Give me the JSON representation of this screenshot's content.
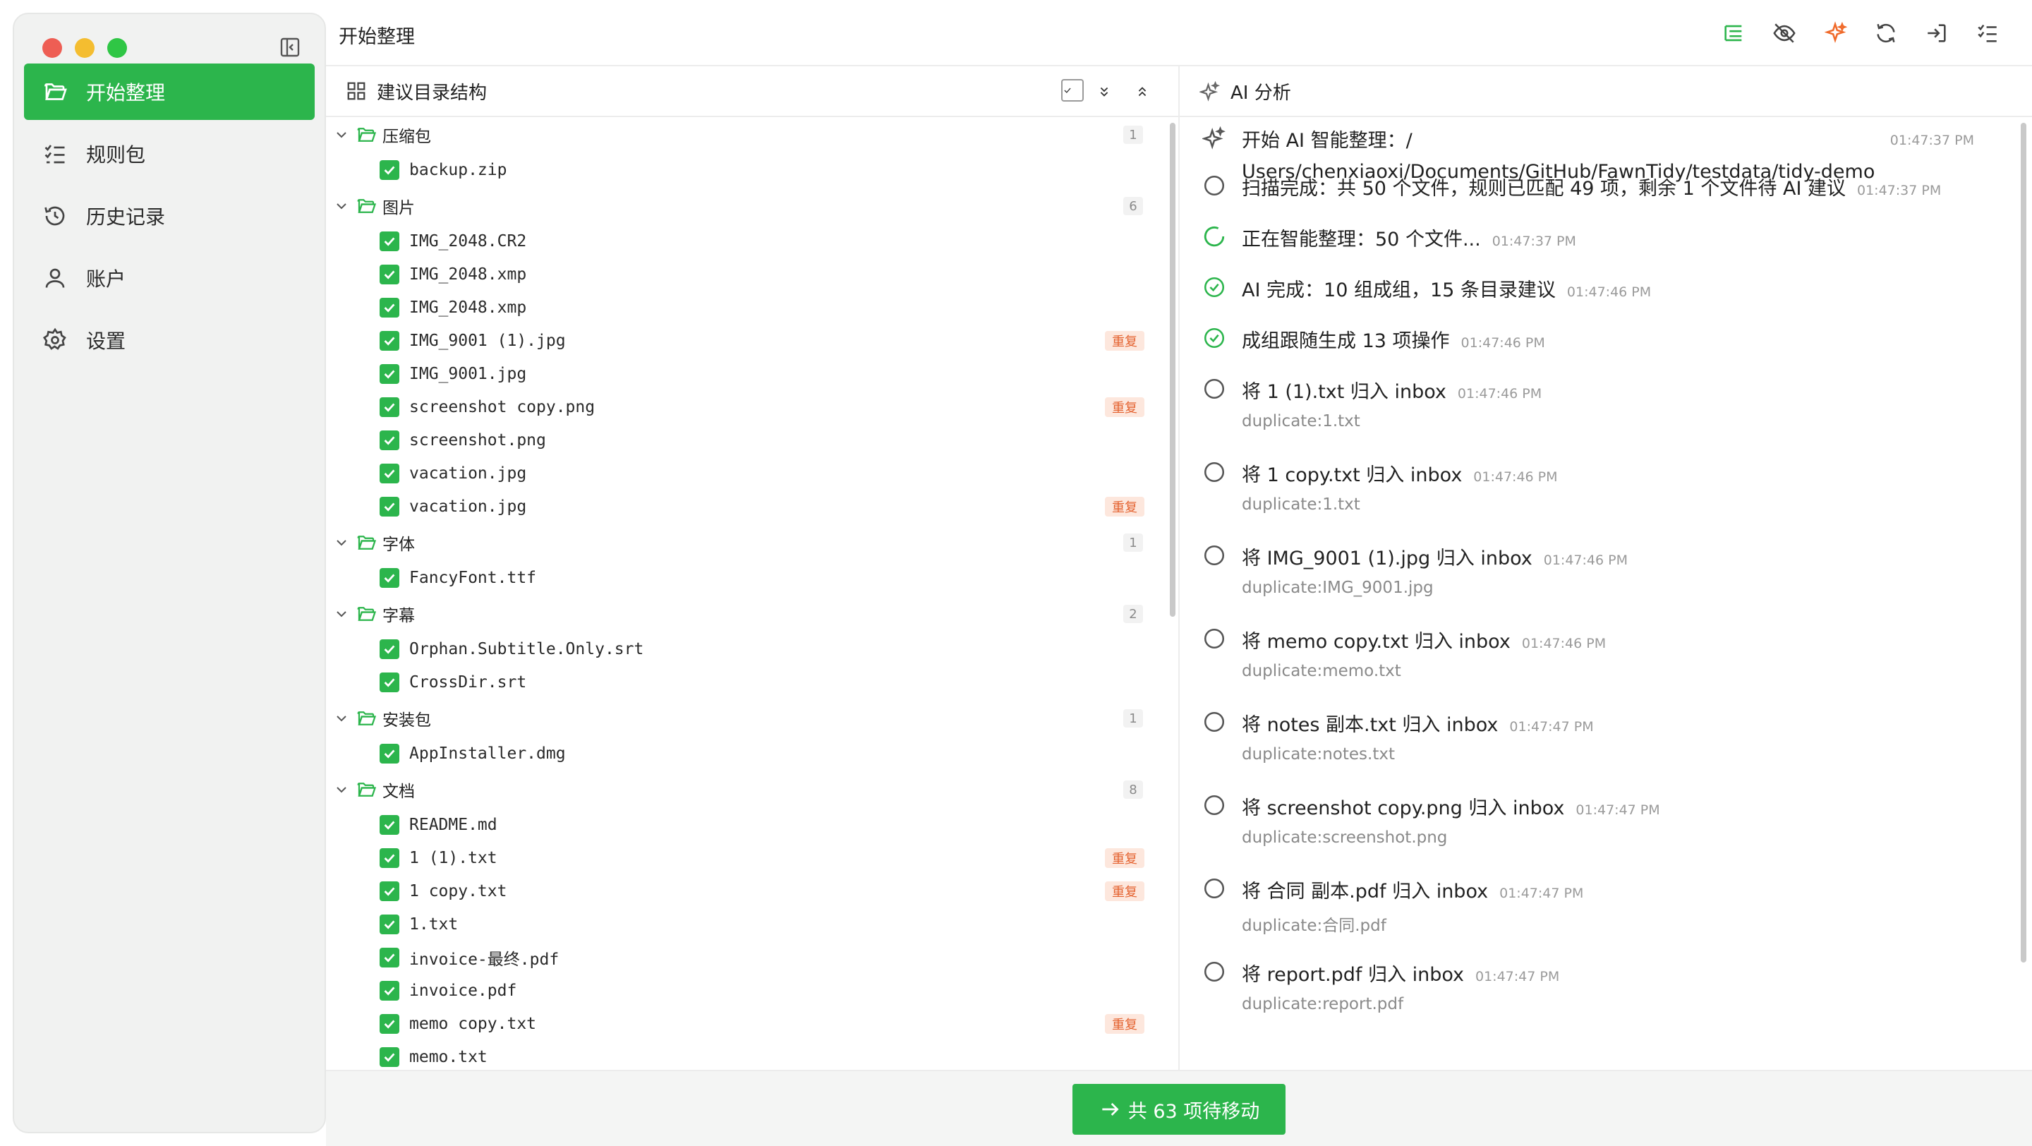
{
  "app": {
    "header_title": "开始整理"
  },
  "colors": {
    "accent": "#2cb54c",
    "duplicate_bg": "#fde7dd",
    "duplicate_text": "#e4622f",
    "ai_icon": "#f06a2a"
  },
  "sidebar": {
    "items": [
      {
        "label": "开始整理",
        "icon": "folder-open-icon",
        "active": true
      },
      {
        "label": "规则包",
        "icon": "checklist-icon",
        "active": false
      },
      {
        "label": "历史记录",
        "icon": "history-icon",
        "active": false
      },
      {
        "label": "账户",
        "icon": "user-icon",
        "active": false
      },
      {
        "label": "设置",
        "icon": "gear-icon",
        "active": false
      }
    ]
  },
  "toolbar": {
    "icons": [
      "tree-list-icon",
      "eye-off-icon",
      "ai-sparkle-icon",
      "refresh-icon",
      "import-icon",
      "checklist-icon"
    ]
  },
  "left_panel": {
    "title": "建议目录结构",
    "groups": [
      {
        "name": "压缩包",
        "count": "1",
        "files": [
          {
            "name": "backup.zip",
            "dup": ""
          }
        ]
      },
      {
        "name": "图片",
        "count": "6",
        "files": [
          {
            "name": "IMG_2048.CR2",
            "dup": ""
          },
          {
            "name": "IMG_2048.xmp",
            "dup": ""
          },
          {
            "name": "IMG_2048.xmp",
            "dup": ""
          },
          {
            "name": "IMG_9001 (1).jpg",
            "dup": "重复"
          },
          {
            "name": "IMG_9001.jpg",
            "dup": ""
          },
          {
            "name": "screenshot copy.png",
            "dup": "重复"
          },
          {
            "name": "screenshot.png",
            "dup": ""
          },
          {
            "name": "vacation.jpg",
            "dup": ""
          },
          {
            "name": "vacation.jpg",
            "dup": "重复"
          }
        ]
      },
      {
        "name": "字体",
        "count": "1",
        "files": [
          {
            "name": "FancyFont.ttf",
            "dup": ""
          }
        ]
      },
      {
        "name": "字幕",
        "count": "2",
        "files": [
          {
            "name": "Orphan.Subtitle.Only.srt",
            "dup": ""
          },
          {
            "name": "CrossDir.srt",
            "dup": ""
          }
        ]
      },
      {
        "name": "安装包",
        "count": "1",
        "files": [
          {
            "name": "AppInstaller.dmg",
            "dup": ""
          }
        ]
      },
      {
        "name": "文档",
        "count": "8",
        "files": [
          {
            "name": "README.md",
            "dup": ""
          },
          {
            "name": "1 (1).txt",
            "dup": "重复"
          },
          {
            "name": "1 copy.txt",
            "dup": "重复"
          },
          {
            "name": "1.txt",
            "dup": ""
          },
          {
            "name": "invoice-最终.pdf",
            "dup": ""
          },
          {
            "name": "invoice.pdf",
            "dup": ""
          },
          {
            "name": "memo copy.txt",
            "dup": "重复"
          },
          {
            "name": "memo.txt",
            "dup": ""
          }
        ]
      }
    ]
  },
  "right_panel": {
    "title": "AI 分析",
    "log": [
      {
        "type": "sparkle",
        "text": "开始 AI 智能整理：/ Users/chenxiaoxi/Documents/GitHub/FawnTidy/testdata/tidy-demo",
        "time": "01:47:37 PM",
        "sub": ""
      },
      {
        "type": "circle",
        "text": "扫描完成：共 50 个文件，规则已匹配 49 项，剩余 1 个文件待 AI 建议",
        "time": "01:47:37 PM",
        "sub": ""
      },
      {
        "type": "spinner",
        "text": "正在智能整理：50 个文件...",
        "time": "01:47:37 PM",
        "sub": ""
      },
      {
        "type": "check",
        "text": "AI 完成：10 组成组，15 条目录建议",
        "time": "01:47:46 PM",
        "sub": ""
      },
      {
        "type": "check",
        "text": "成组跟随生成 13 项操作",
        "time": "01:47:46 PM",
        "sub": ""
      },
      {
        "type": "circle",
        "text": "将 1 (1).txt 归入 inbox",
        "time": "01:47:46 PM",
        "sub": "duplicate:1.txt"
      },
      {
        "type": "circle",
        "text": "将 1 copy.txt 归入 inbox",
        "time": "01:47:46 PM",
        "sub": "duplicate:1.txt"
      },
      {
        "type": "circle",
        "text": "将 IMG_9001 (1).jpg 归入 inbox",
        "time": "01:47:46 PM",
        "sub": "duplicate:IMG_9001.jpg"
      },
      {
        "type": "circle",
        "text": "将 memo copy.txt 归入 inbox",
        "time": "01:47:46 PM",
        "sub": "duplicate:memo.txt"
      },
      {
        "type": "circle",
        "text": "将 notes 副本.txt 归入 inbox",
        "time": "01:47:47 PM",
        "sub": "duplicate:notes.txt"
      },
      {
        "type": "circle",
        "text": "将 screenshot copy.png 归入 inbox",
        "time": "01:47:47 PM",
        "sub": "duplicate:screenshot.png"
      },
      {
        "type": "circle",
        "text": "将 合同 副本.pdf 归入 inbox",
        "time": "01:47:47 PM",
        "sub": "duplicate:合同.pdf"
      },
      {
        "type": "circle",
        "text": "将 report.pdf 归入 inbox",
        "time": "01:47:47 PM",
        "sub": "duplicate:report.pdf"
      }
    ]
  },
  "footer": {
    "move_label": "共 63 项待移动"
  }
}
